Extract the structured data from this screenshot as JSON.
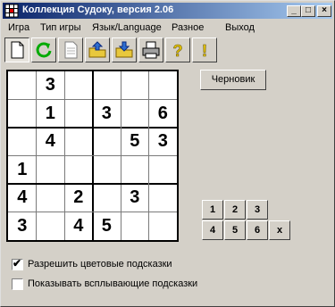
{
  "window": {
    "title": "Коллекция Судоку, версия 2.06",
    "min": "_",
    "max": "□",
    "close": "×"
  },
  "menu": [
    "Игра",
    "Тип игры",
    "Язык/Language",
    "Разное",
    "Выход"
  ],
  "toolbar": [
    {
      "name": "new-game-button",
      "icon": "blank-page-icon"
    },
    {
      "name": "restart-button",
      "icon": "green-refresh-icon"
    },
    {
      "name": "document-button",
      "icon": "page-icon"
    },
    {
      "name": "open-button",
      "icon": "folder-up-icon"
    },
    {
      "name": "save-button",
      "icon": "folder-down-icon"
    },
    {
      "name": "print-button",
      "icon": "printer-icon"
    },
    {
      "name": "help-button",
      "icon": "question-icon"
    },
    {
      "name": "about-button",
      "icon": "exclamation-icon"
    }
  ],
  "board": [
    [
      "",
      "3",
      "",
      "",
      "",
      ""
    ],
    [
      "",
      "1",
      "",
      "3",
      "",
      "6"
    ],
    [
      "",
      "4",
      "",
      "",
      "5",
      "3"
    ],
    [
      "1",
      "",
      "",
      "",
      "",
      ""
    ],
    [
      "4",
      "",
      "2",
      "",
      "3",
      ""
    ],
    [
      "3",
      "",
      "4",
      "5",
      "",
      ""
    ]
  ],
  "draft_button": "Черновик",
  "number_pad": [
    [
      "1",
      "2",
      "3"
    ],
    [
      "4",
      "5",
      "6",
      "x"
    ]
  ],
  "options": [
    {
      "label": "Разрешить цветовые подсказки",
      "checked": true,
      "mark": "✔"
    },
    {
      "label": "Показывать всплывающие подсказки",
      "checked": false,
      "mark": ""
    }
  ]
}
